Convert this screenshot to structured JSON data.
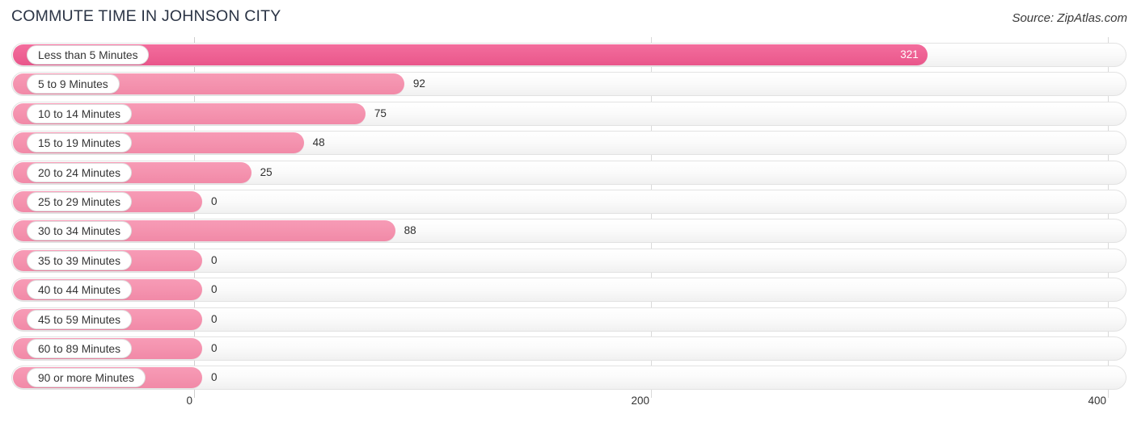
{
  "header": {
    "title": "COMMUTE TIME IN JOHNSON CITY",
    "source": "Source: ZipAtlas.com"
  },
  "colors": {
    "bar_primary": "#EE6193",
    "bar_secondary": "#F492AE",
    "track_border": "#E2E2E2",
    "gridline": "#D9D9D9",
    "title_text": "#2B3445",
    "value_text": "#2F2F2F",
    "value_text_inside": "#FFFFFF"
  },
  "chart_data": {
    "type": "bar",
    "orientation": "horizontal",
    "title": "COMMUTE TIME IN JOHNSON CITY",
    "subtitle": "",
    "xlabel": "",
    "ylabel": "",
    "xlim": [
      0,
      400
    ],
    "xticks": [
      0,
      200,
      400
    ],
    "xtick_labels": [
      "0",
      "200",
      "400"
    ],
    "grid": true,
    "legend": false,
    "categories": [
      "Less than 5 Minutes",
      "5 to 9 Minutes",
      "10 to 14 Minutes",
      "15 to 19 Minutes",
      "20 to 24 Minutes",
      "25 to 29 Minutes",
      "30 to 34 Minutes",
      "35 to 39 Minutes",
      "40 to 44 Minutes",
      "45 to 59 Minutes",
      "60 to 89 Minutes",
      "90 or more Minutes"
    ],
    "values": [
      321,
      92,
      75,
      48,
      25,
      0,
      88,
      0,
      0,
      0,
      0,
      0
    ],
    "value_labels": [
      "321",
      "92",
      "75",
      "48",
      "25",
      "0",
      "88",
      "0",
      "0",
      "0",
      "0",
      "0"
    ]
  },
  "xaxis": {
    "ticks": [
      {
        "label": "0",
        "x": 240
      },
      {
        "label": "200",
        "x": 805
      },
      {
        "label": "400",
        "x": 1370
      }
    ]
  }
}
